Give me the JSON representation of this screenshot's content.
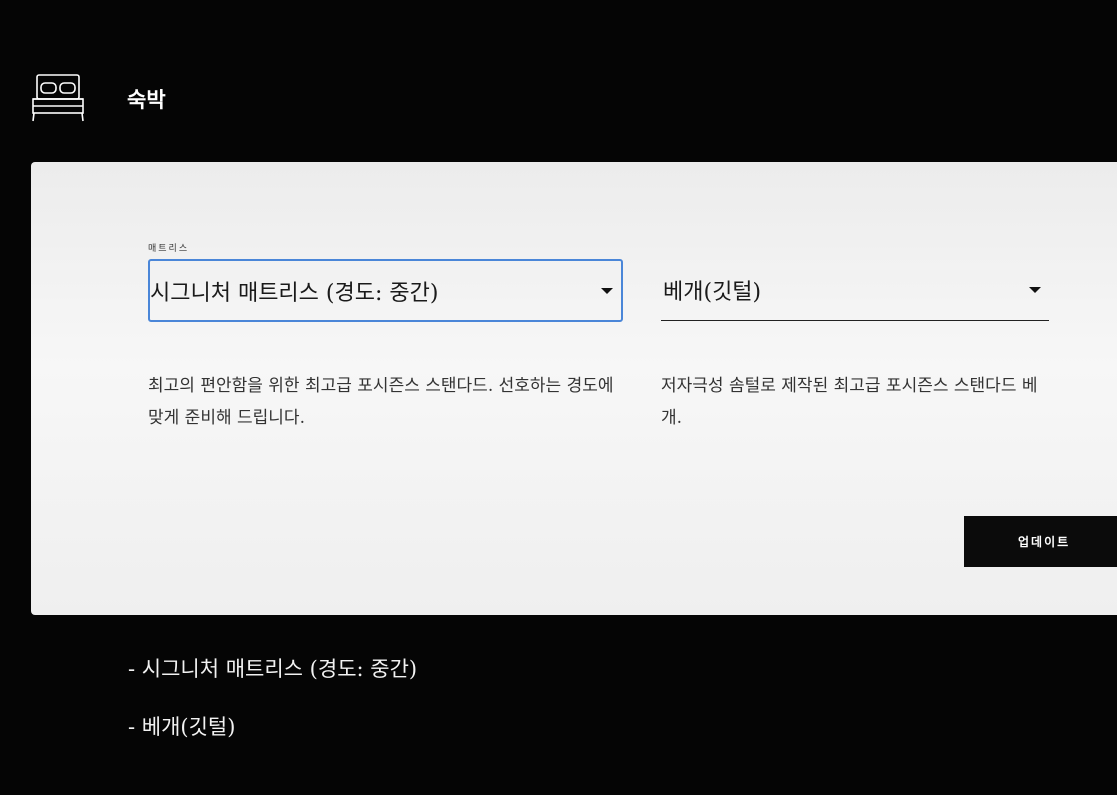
{
  "section": {
    "icon": "bed-icon",
    "title": "숙박"
  },
  "mattress": {
    "caption": "매트리스",
    "selected": "시그니처 매트리스 (경도: 중간)",
    "description": "최고의 편안함을 위한 최고급 포시즌스 스탠다드. 선호하는 경도에 맞게 준비해 드립니다."
  },
  "pillow": {
    "selected": "베개(깃털)",
    "description": "저자극성 솜털로 제작된 최고급 포시즌스 스탠다드 베개."
  },
  "update_label": "업데이트",
  "summary": [
    "- 시그니처 매트리스 (경도: 중간)",
    "- 베개(깃털)"
  ],
  "colors": {
    "focus_border": "#4a86d8",
    "button_bg": "#0b0b0b"
  }
}
